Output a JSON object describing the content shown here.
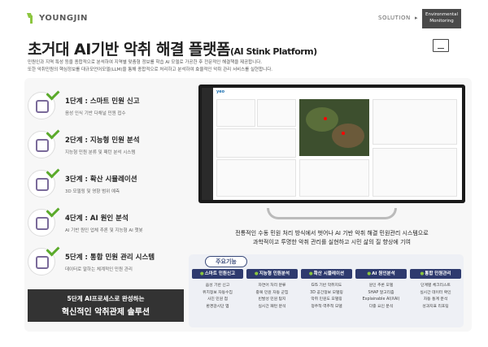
{
  "header": {
    "logo": "YOUNGJIN",
    "solution": "SOLUTION",
    "arrow": "▸",
    "env_line1": "Environmental",
    "env_line2": "Monitoring",
    "title": "초거대 AI기반 악취 해결 플랫폼",
    "title_en": "(AI Stink Platform)",
    "desc_line1": "민원인과 지역 특성 등을 종합적으로 분석하여 지역별 맞춤형 정보를 학습 AI 모델로 가공한 후 전문적인 해결책을 제공합니다.",
    "desc_line2": "또한 악취민원의 핵심정보를 대규모언어모델(LLM)을 통해 종합적으로 처리하고 분석하여 효율적인 악취 관리 서비스를 실현합니다."
  },
  "steps": [
    {
      "title": "1단계 : 스마트 민원 신고",
      "sub": "음성 인식 기반 다채널 민원 접수"
    },
    {
      "title": "2단계 : 지능형 민원 분석",
      "sub": "지능형 민원 분류 및 패턴 분석 시스템"
    },
    {
      "title": "3단계 : 확산 시뮬레이션",
      "sub": "3D 모델링 및 영향 범위 예측"
    },
    {
      "title": "4단계 : AI 원인 분석",
      "sub": "AI 기반 원인 업체 추론 및 지능형 AI 챗봇"
    },
    {
      "title": "5단계 : 통합 민원 관리 시스템",
      "sub": "데이터로 말하는 체계적인 민원 관리"
    }
  ],
  "summary": {
    "line1": "5단계 AI프로세스로 완성하는",
    "line2": "혁신적인 악취관제 솔루션"
  },
  "screen": {
    "logo": "yeo"
  },
  "tv_desc": {
    "line1": "전통적인 수동 민원 처리 방식에서 벗어나 AI 기반 악취 해결 민원관리 시스템으로",
    "line2": "과학적이고 투명한 악취 관리를 실현하고 시민 삶의 질 향상에 기여"
  },
  "key": {
    "title": "주요기능",
    "features": [
      {
        "head": "스마트 민원신고",
        "lines": [
          "음성 기반 신고",
          "위치정보 자동수집",
          "사진 민원 첨",
          "환경감시단 앱"
        ]
      },
      {
        "head": "지능형 민원분석",
        "lines": [
          "자연어 처리 분류",
          "중복 민원 자동 군집",
          "빈발성 민원 탐지",
          "실시간 패턴 분석"
        ]
      },
      {
        "head": "확산 시뮬레이션",
        "lines": [
          "GIS 기반 악취지도",
          "3D 공간정보 모델링",
          "악취 민원도 모델링",
          "정주적·역추적 모델"
        ]
      },
      {
        "head": "AI 원인분석",
        "lines": [
          "원인 추론 모델",
          "SHAP 알고리즘",
          "Explainable AI(XAI)",
          "다중 요인 분석"
        ]
      },
      {
        "head": "통합 민원관리",
        "lines": [
          "단계별 체크리스트",
          "실시간 데이터 확인",
          "자동 통계 분석",
          "성과지표 리포팅"
        ]
      }
    ]
  },
  "colors": {
    "accent_navy": "#2e3a6e",
    "accent_green": "#8cc63f",
    "dark_box": "#333333"
  }
}
